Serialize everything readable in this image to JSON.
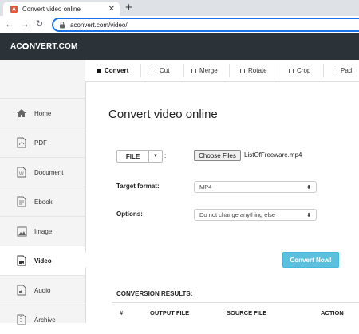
{
  "browser": {
    "tab_title": "Convert video online",
    "tab_close": "✕",
    "new_tab": "+",
    "url": "aconvert.com/video/"
  },
  "site": {
    "logo": "AC☉NVERT.COM"
  },
  "tool_tabs": [
    {
      "label": "Convert",
      "active": true
    },
    {
      "label": "Cut"
    },
    {
      "label": "Merge"
    },
    {
      "label": "Rotate"
    },
    {
      "label": "Crop"
    },
    {
      "label": "Pad"
    }
  ],
  "sidebar": {
    "items": [
      {
        "label": "Home",
        "icon": "home-icon"
      },
      {
        "label": "PDF",
        "icon": "pdf-icon"
      },
      {
        "label": "Document",
        "icon": "document-icon"
      },
      {
        "label": "Ebook",
        "icon": "ebook-icon"
      },
      {
        "label": "Image",
        "icon": "image-icon"
      },
      {
        "label": "Video",
        "icon": "video-icon",
        "active": true
      },
      {
        "label": "Audio",
        "icon": "audio-icon"
      },
      {
        "label": "Archive",
        "icon": "archive-icon"
      }
    ]
  },
  "main": {
    "title": "Convert video online",
    "file_button": "FILE",
    "file_colon": ":",
    "choose_files": "Choose Files",
    "file_name": "ListOfFreeware.mp4",
    "target_label": "Target format:",
    "target_value": "MP4",
    "options_label": "Options:",
    "options_value": "Do not change anything else",
    "convert_now": "Convert Now!",
    "results_title": "CONVERSION RESULTS:",
    "results_columns": [
      "#",
      "OUTPUT FILE",
      "SOURCE FILE",
      "ACTION"
    ]
  },
  "colors": {
    "header_bg": "#2c3338",
    "accent": "#5bc0de",
    "address_focus": "#1a73e8"
  }
}
